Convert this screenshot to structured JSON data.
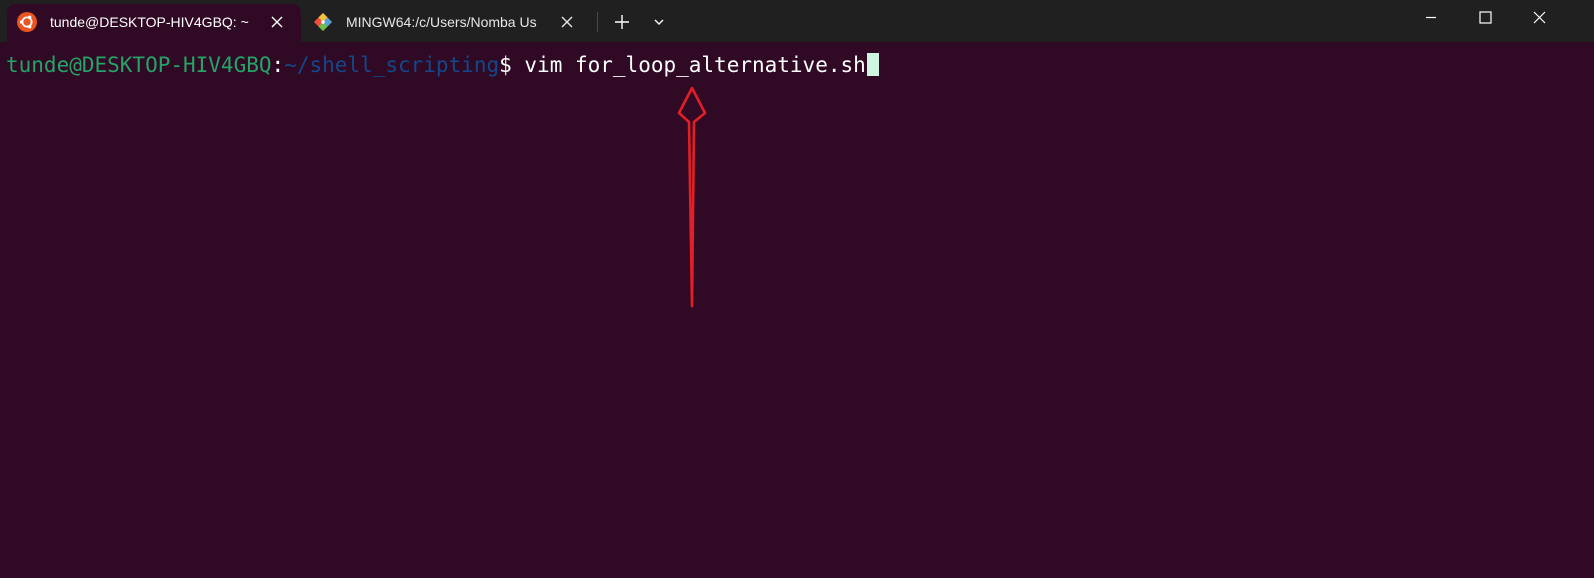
{
  "tabs": [
    {
      "label": "tunde@DESKTOP-HIV4GBQ: ~",
      "icon": "ubuntu-icon",
      "active": true
    },
    {
      "label": "MINGW64:/c/Users/Nomba Us",
      "icon": "git-icon",
      "active": false
    }
  ],
  "terminal": {
    "user_host": "tunde@DESKTOP-HIV4GBQ",
    "colon": ":",
    "path": "~/shell_scripting",
    "dollar": "$",
    "command": " vim for_loop_alternative.sh"
  },
  "colors": {
    "terminal_bg": "#300a24",
    "tabbar_bg": "#202020",
    "prompt_user": "#26a269",
    "prompt_path": "#12488b",
    "cursor": "#cdf5e0",
    "annotation_arrow": "#e21f26"
  },
  "icons": [
    "ubuntu-icon",
    "git-icon",
    "close-icon",
    "plus-icon",
    "chevron-down-icon",
    "minimize-icon",
    "maximize-icon",
    "window-close-icon"
  ]
}
